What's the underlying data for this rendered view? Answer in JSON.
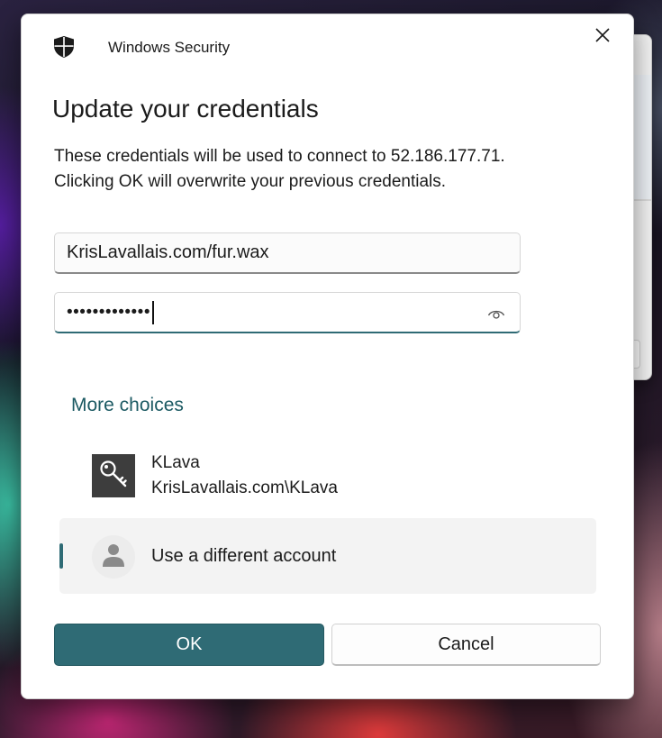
{
  "window": {
    "title": "Windows Security"
  },
  "dialog": {
    "heading": "Update your credentials",
    "description_line1": "These credentials will be used to connect to 52.186.177.71.",
    "description_line2": "Clicking OK will overwrite your previous credentials."
  },
  "form": {
    "username_value": "KrisLavallais.com/fur.wax",
    "password_masked": "•••••••••••••"
  },
  "more_choices": {
    "label": "More choices",
    "accounts": [
      {
        "name": "KLava",
        "detail": "KrisLavallais.com\\KLava",
        "icon": "key-icon"
      },
      {
        "name": "Use a different account",
        "icon": "person-icon",
        "selected": true
      }
    ]
  },
  "buttons": {
    "ok": "OK",
    "cancel": "Cancel"
  },
  "colors": {
    "accent": "#2f6b75",
    "link": "#1c5a63"
  },
  "icons": {
    "app": "shield-icon",
    "close": "close-icon",
    "reveal": "eye-icon"
  }
}
